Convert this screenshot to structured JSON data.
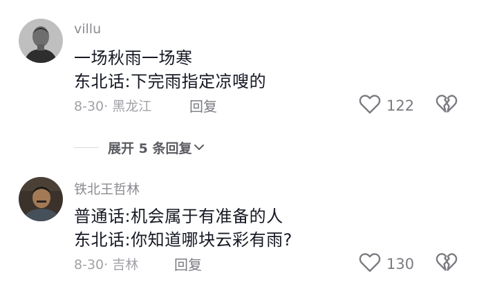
{
  "comments": [
    {
      "username": "villu",
      "lines": [
        "一场秋雨一场寒",
        "东北话:下完雨指定凉嗖的"
      ],
      "date": "8-30",
      "location": "黑龙江",
      "reply_label": "回复",
      "like_count": "122",
      "avatar_icon": "avatar-photo"
    },
    {
      "username": "铁北王哲林",
      "lines": [
        "普通话:机会属于有准备的人",
        "东北话:你知道哪块云彩有雨?"
      ],
      "date": "8-30",
      "location": "吉林",
      "reply_label": "回复",
      "like_count": "130",
      "avatar_icon": "avatar-photo"
    }
  ],
  "expand_replies": {
    "label": "展开 5 条回复",
    "icon": "chevron-down-icon"
  },
  "icons": {
    "like": "heart-outline-icon",
    "dislike": "broken-heart-icon"
  },
  "colors": {
    "text": "#161823",
    "secondary": "#8a8b91",
    "icon": "#7a7b80"
  }
}
